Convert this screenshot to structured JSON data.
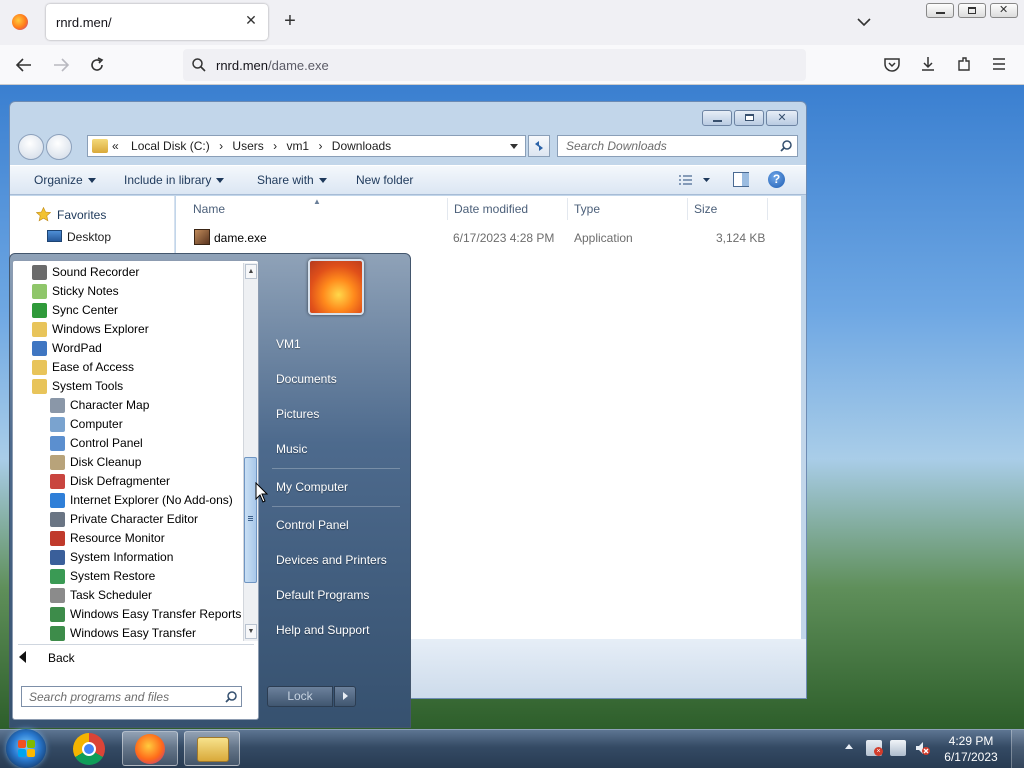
{
  "browser": {
    "tab_title": "rnrd.men/",
    "url_host": "rnrd.men",
    "url_path": "/dame.exe",
    "new_tab": "+",
    "close_tab": "✕"
  },
  "explorer": {
    "breadcrumb": [
      "«",
      "Local Disk (C:)",
      "›",
      "Users",
      "›",
      "vm1",
      "›",
      "Downloads"
    ],
    "search_placeholder": "Search Downloads",
    "toolbar": {
      "organize": "Organize",
      "include": "Include in library",
      "share": "Share with",
      "new_folder": "New folder"
    },
    "nav": {
      "favorites": "Favorites",
      "desktop": "Desktop"
    },
    "columns": {
      "name": "Name",
      "date": "Date modified",
      "type": "Type",
      "size": "Size"
    },
    "files": [
      {
        "name": "dame.exe",
        "date": "6/17/2023 4:28 PM",
        "type": "Application",
        "size": "3,124 KB"
      }
    ]
  },
  "start_menu": {
    "programs": [
      {
        "label": "Sound Recorder",
        "icon": "microphone-icon",
        "color": "#6b6b6b"
      },
      {
        "label": "Sticky Notes",
        "icon": "sticky-notes-icon",
        "color": "#8fc66a"
      },
      {
        "label": "Sync Center",
        "icon": "sync-icon",
        "color": "#2f9a3a"
      },
      {
        "label": "Windows Explorer",
        "icon": "folder-icon",
        "color": "#e8c45a"
      },
      {
        "label": "WordPad",
        "icon": "wordpad-icon",
        "color": "#3f76c2"
      },
      {
        "label": "Ease of Access",
        "icon": "folder-icon",
        "color": "#e8c45a"
      },
      {
        "label": "System Tools",
        "icon": "folder-icon",
        "color": "#e8c45a"
      }
    ],
    "system_tools": [
      {
        "label": "Character Map",
        "icon": "character-map-icon",
        "color": "#8a97a8"
      },
      {
        "label": "Computer",
        "icon": "computer-icon",
        "color": "#7aa3cf"
      },
      {
        "label": "Control Panel",
        "icon": "control-panel-icon",
        "color": "#5b8fcf"
      },
      {
        "label": "Disk Cleanup",
        "icon": "disk-cleanup-icon",
        "color": "#b8a37a"
      },
      {
        "label": "Disk Defragmenter",
        "icon": "defrag-icon",
        "color": "#c9453f"
      },
      {
        "label": "Internet Explorer (No Add-ons)",
        "icon": "ie-icon",
        "color": "#2f7fd8"
      },
      {
        "label": "Private Character Editor",
        "icon": "char-editor-icon",
        "color": "#6a7584"
      },
      {
        "label": "Resource Monitor",
        "icon": "resource-monitor-icon",
        "color": "#c03a2b"
      },
      {
        "label": "System Information",
        "icon": "system-info-icon",
        "color": "#3a5f9a"
      },
      {
        "label": "System Restore",
        "icon": "system-restore-icon",
        "color": "#3a9a54"
      },
      {
        "label": "Task Scheduler",
        "icon": "clock-icon",
        "color": "#8b8b8b"
      },
      {
        "label": "Windows Easy Transfer Reports",
        "icon": "transfer-icon",
        "color": "#3d8c4a"
      },
      {
        "label": "Windows Easy Transfer",
        "icon": "transfer-icon",
        "color": "#3d8c4a"
      }
    ],
    "back": "Back",
    "search_placeholder": "Search programs and files",
    "right": [
      "VM1",
      "Documents",
      "Pictures",
      "Music",
      "My Computer",
      "Control Panel",
      "Devices and Printers",
      "Default Programs",
      "Help and Support"
    ],
    "lock": "Lock"
  },
  "taskbar": {
    "time": "4:29 PM",
    "date": "6/17/2023"
  }
}
